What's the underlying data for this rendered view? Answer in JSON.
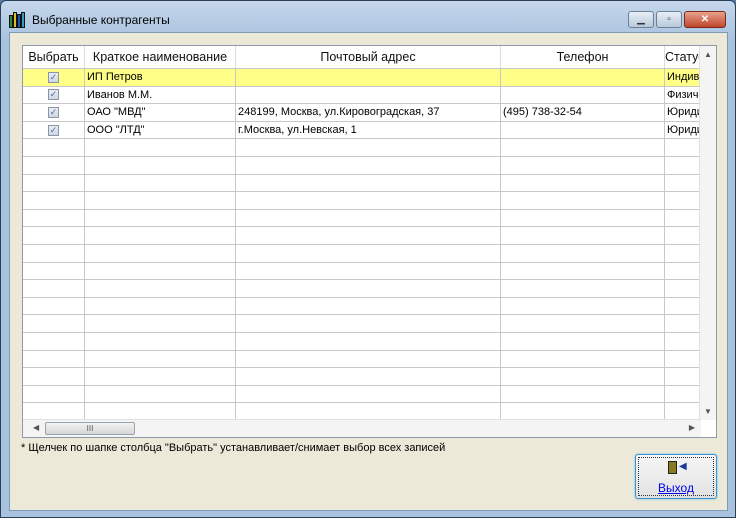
{
  "window": {
    "title": "Выбранные контрагенты"
  },
  "grid": {
    "columns": [
      "Выбрать",
      "Краткое наименование",
      "Почтовый адрес",
      "Телефон",
      "Статус"
    ],
    "rows": [
      {
        "checked": true,
        "name": "ИП Петров",
        "address": "",
        "phone": "",
        "status": "Индивидуальный предприниматель"
      },
      {
        "checked": true,
        "name": "Иванов М.М.",
        "address": "",
        "phone": "",
        "status": "Физическое лицо"
      },
      {
        "checked": true,
        "name": "ОАО \"МВД\"",
        "address": "248199, Москва, ул.Кировоградская, 37",
        "phone": "(495) 738-32-54",
        "status": "Юридическое лицо"
      },
      {
        "checked": true,
        "name": "ООО \"ЛТД\"",
        "address": "г.Москва, ул.Невская, 1",
        "phone": "",
        "status": "Юридическое лицо"
      }
    ],
    "selected_row": 0
  },
  "note": "* Щелчек по шапке столбца \"Выбрать\" устанавливает/снимает выбор всех записей",
  "exit_button": {
    "label": "Выход"
  }
}
